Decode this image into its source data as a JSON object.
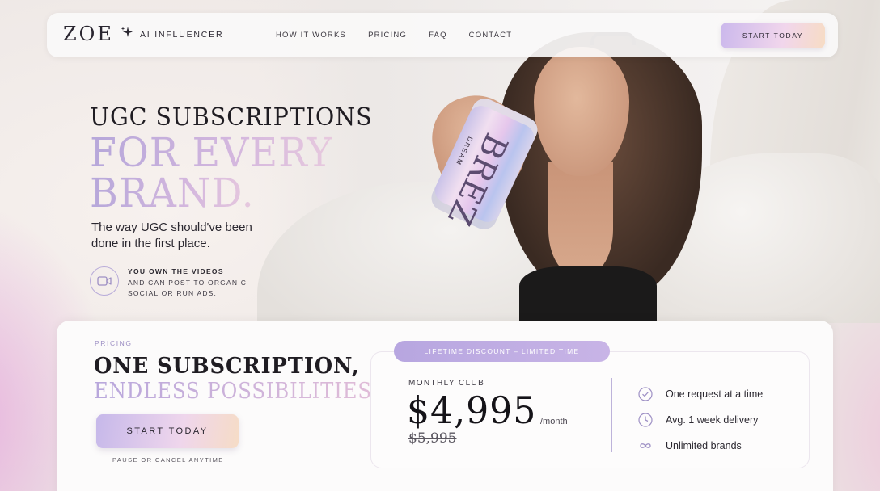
{
  "nav": {
    "logo": "ZOE",
    "logo_sub": "AI INFLUENCER",
    "links": [
      "HOW IT WORKS",
      "PRICING",
      "FAQ",
      "CONTACT"
    ],
    "cta": "START TODAY"
  },
  "hero": {
    "headline_line1": "UGC SUBSCRIPTIONS",
    "headline_line2": "FOR EVERY",
    "headline_line3": "BRAND.",
    "tagline": "The way UGC should've been done in the first place.",
    "ownership_title": "YOU OWN THE VIDEOS",
    "ownership_desc": "AND CAN POST TO ORGANIC SOCIAL OR RUN ADS.",
    "product_can_brand": "BREZ",
    "product_can_flavor": "DREAM"
  },
  "pricing": {
    "eyebrow": "PRICING",
    "title_line1": "ONE SUBSCRIPTION,",
    "title_line2": "ENDLESS POSSIBILITIES",
    "cta": "START TODAY",
    "note": "PAUSE OR CANCEL ANYTIME",
    "badge": "LIFETIME DISCOUNT – LIMITED TIME",
    "plan_name": "MONTHLY CLUB",
    "price": "$4,995",
    "period": "/month",
    "old_price": "$5,995",
    "features": [
      {
        "icon": "check-circle-icon",
        "text": "One request at a time"
      },
      {
        "icon": "clock-icon",
        "text": "Avg. 1 week delivery"
      },
      {
        "icon": "infinity-icon",
        "text": "Unlimited brands"
      }
    ]
  },
  "colors": {
    "accent_lavender": "#b7a6e0",
    "gradient_pink": "#efd6ec",
    "gradient_peach": "#f6dcc6",
    "text_dark": "#1f1c22"
  }
}
